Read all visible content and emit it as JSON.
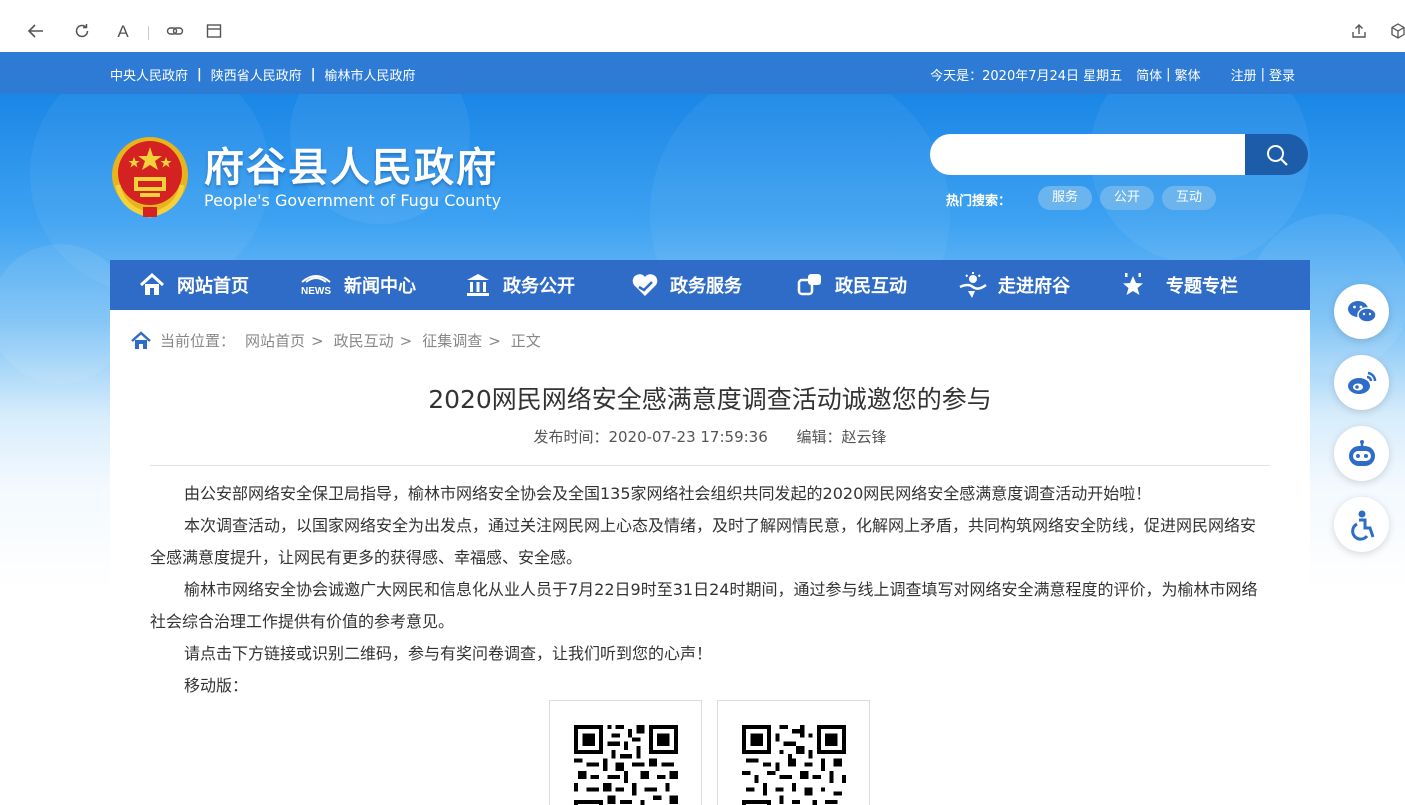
{
  "browser": {
    "back_icon": "back-arrow-icon",
    "reload_icon": "reload-icon",
    "font_label": "A",
    "link_icon": "link-icon",
    "reader_icon": "reader-icon",
    "share_icon": "share-icon",
    "box_icon": "cube-icon"
  },
  "top_strip": {
    "links": [
      "中央人民政府",
      "陕西省人民政府",
      "榆林市人民政府"
    ],
    "date_text": "今天是：2020年7月24日  星期五",
    "lang_simple": "简体",
    "lang_sep": "|",
    "lang_trad": "繁体",
    "register": "注册",
    "login_sep": "|",
    "login": "登录"
  },
  "header": {
    "title": "府谷县人民政府",
    "subtitle": "People's Government of Fugu County",
    "search_placeholder": "",
    "hot_label": "热门搜索：",
    "hot_tags": [
      "服务",
      "公开",
      "互动"
    ]
  },
  "nav": {
    "items": [
      {
        "label": "网站首页",
        "icon": "home-icon"
      },
      {
        "label": "新闻中心",
        "icon": "news-icon"
      },
      {
        "label": "政务公开",
        "icon": "government-building-icon"
      },
      {
        "label": "政务服务",
        "icon": "heart-hand-icon"
      },
      {
        "label": "政民互动",
        "icon": "interaction-icon"
      },
      {
        "label": "走进府谷",
        "icon": "landscape-icon"
      },
      {
        "label": "专题专栏",
        "icon": "star-icon"
      }
    ]
  },
  "breadcrumb": {
    "label": "当前位置：",
    "items": [
      "网站首页",
      "政民互动",
      "征集调查",
      "正文"
    ]
  },
  "article": {
    "title": "2020网民网络安全感满意度调查活动诚邀您的参与",
    "publish_time": "发布时间：2020-07-23 17:59:36",
    "editor": "编辑：赵云锋",
    "paragraphs": [
      "由公安部网络安全保卫局指导，榆林市网络安全协会及全国135家网络社会组织共同发起的2020网民网络安全感满意度调查活动开始啦！",
      "本次调查活动，以国家网络安全为出发点，通过关注网民网上心态及情绪，及时了解网情民意，化解网上矛盾，共同构筑网络安全防线，促进网民网络安全感满意度提升，让网民有更多的获得感、幸福感、安全感。",
      "榆林市网络安全协会诚邀广大网民和信息化从业人员于7月22日9时至31日24时期间，通过参与线上调查填写对网络安全满意程度的评价，为榆林市网络社会综合治理工作提供有价值的参考意见。",
      "请点击下方链接或识别二维码，参与有奖问卷调查，让我们听到您的心声！",
      "移动版："
    ]
  },
  "float_share": [
    "wechat-icon",
    "weibo-icon",
    "robot-icon",
    "accessibility-icon"
  ],
  "colors": {
    "strip": "#2e7bd6",
    "nav": "#2f6cc8",
    "search_btn": "#1d5ca9",
    "tag": "#6cb4ee"
  }
}
